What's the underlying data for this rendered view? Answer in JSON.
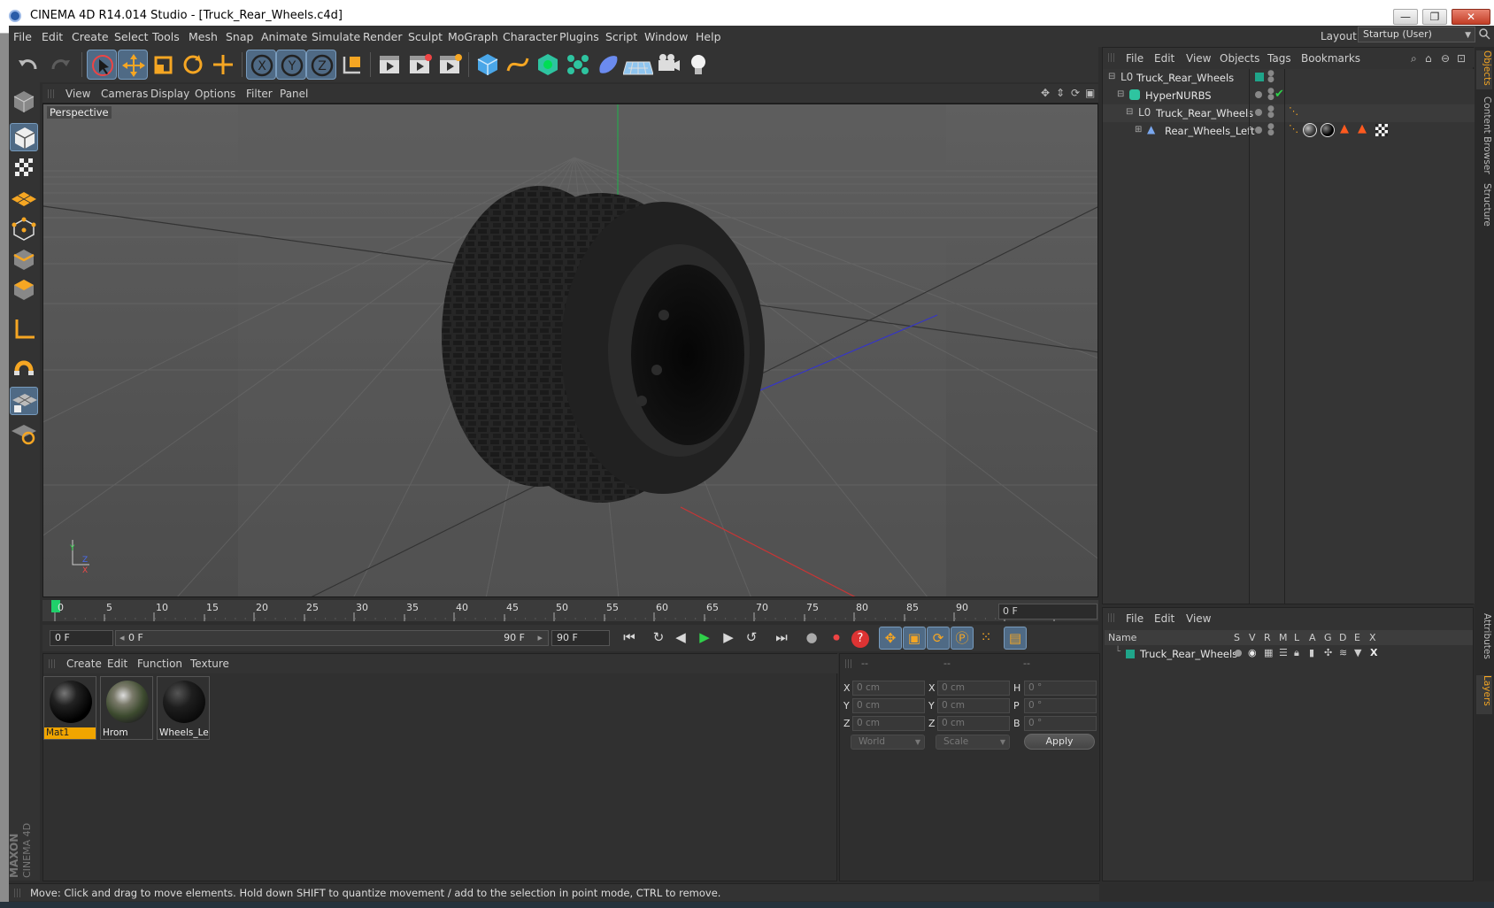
{
  "window": {
    "title": "CINEMA 4D R14.014 Studio - [Truck_Rear_Wheels.c4d]",
    "minimize_glyph": "—",
    "maximize_glyph": "❐",
    "close_glyph": "✕"
  },
  "menu": [
    "File",
    "Edit",
    "Create",
    "Select",
    "Tools",
    "Mesh",
    "Snap",
    "Animate",
    "Simulate",
    "Render",
    "Sculpt",
    "MoGraph",
    "Character",
    "Plugins",
    "Script",
    "Window",
    "Help"
  ],
  "layout": {
    "label": "Layout:",
    "value": "Startup (User)"
  },
  "viewport": {
    "menu": [
      "View",
      "Cameras",
      "Display",
      "Options",
      "Filter",
      "Panel"
    ],
    "label": "Perspective"
  },
  "timeline": {
    "ticks": [
      "0",
      "5",
      "10",
      "15",
      "20",
      "25",
      "30",
      "35",
      "40",
      "45",
      "50",
      "55",
      "60",
      "65",
      "70",
      "75",
      "80",
      "85",
      "90"
    ],
    "current_frame": "0 F",
    "start_field": "0 F",
    "slider_start": "0 F",
    "slider_end": "90 F",
    "end_field": "90 F"
  },
  "materials": {
    "menu": [
      "Create",
      "Edit",
      "Function",
      "Texture"
    ],
    "items": [
      {
        "name": "Mat1",
        "selected": true
      },
      {
        "name": "Hrom",
        "selected": false
      },
      {
        "name": "Wheels_Lef",
        "selected": false
      }
    ]
  },
  "coords": {
    "headers": [
      "--",
      "--",
      "--"
    ],
    "rows": [
      {
        "a": "X",
        "av": "0 cm",
        "b": "X",
        "bv": "0 cm",
        "c": "H",
        "cv": "0 °"
      },
      {
        "a": "Y",
        "av": "0 cm",
        "b": "Y",
        "bv": "0 cm",
        "c": "P",
        "cv": "0 °"
      },
      {
        "a": "Z",
        "av": "0 cm",
        "b": "Z",
        "bv": "0 cm",
        "c": "B",
        "cv": "0 °"
      }
    ],
    "space": "World",
    "mode": "Scale",
    "apply": "Apply"
  },
  "objects": {
    "menu": [
      "File",
      "Edit",
      "View",
      "Objects",
      "Tags",
      "Bookmarks"
    ],
    "items": [
      {
        "name": "Truck_Rear_Wheels"
      },
      {
        "name": "HyperNURBS"
      },
      {
        "name": "Truck_Rear_Wheels"
      },
      {
        "name": "Rear_Wheels_Left"
      }
    ]
  },
  "layers": {
    "menu": [
      "File",
      "Edit",
      "View"
    ],
    "columns": [
      "Name",
      "S",
      "V",
      "R",
      "M",
      "L",
      "A",
      "G",
      "D",
      "E",
      "X"
    ],
    "rows": [
      {
        "name": "Truck_Rear_Wheels"
      }
    ]
  },
  "right_tabs": [
    "Objects",
    "Content Browser",
    "Structure",
    "Attributes",
    "Layers"
  ],
  "status": "Move: Click and drag to move elements. Hold down SHIFT to quantize movement / add to the selection in point mode, CTRL to remove.",
  "brand": {
    "maxon": "MAXON",
    "product": "CINEMA 4D"
  },
  "colors": {
    "accent": "#4f6a85",
    "selected_material": "#f0a500",
    "layer_color": "#1fa58a"
  }
}
